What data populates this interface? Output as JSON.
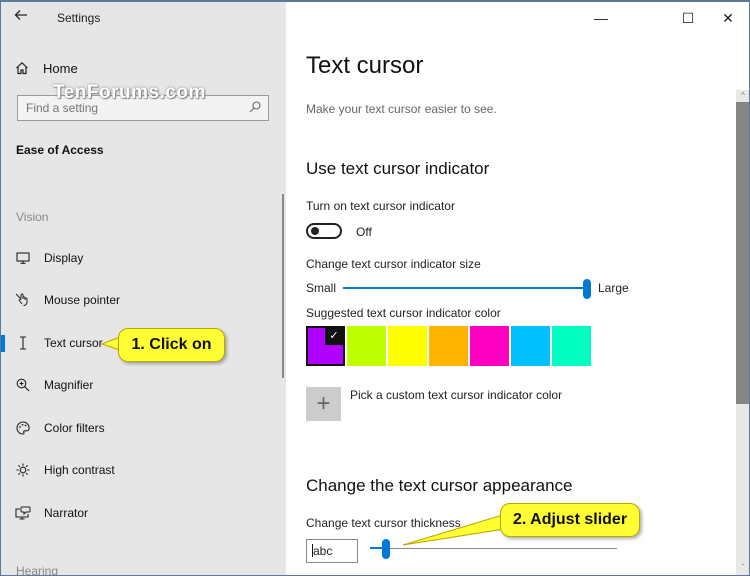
{
  "app": {
    "title": "Settings"
  },
  "sidebar": {
    "home_label": "Home",
    "search": {
      "placeholder": "Find a setting",
      "value": ""
    },
    "section_title": "Ease of Access",
    "groups": [
      {
        "label": "Vision",
        "items": [
          {
            "label": "Display",
            "icon": "display-icon",
            "active": false
          },
          {
            "label": "Mouse pointer",
            "icon": "mouse-pointer-icon",
            "active": false
          },
          {
            "label": "Text cursor",
            "icon": "text-cursor-icon",
            "active": true
          },
          {
            "label": "Magnifier",
            "icon": "magnifier-icon",
            "active": false
          },
          {
            "label": "Color filters",
            "icon": "color-filters-icon",
            "active": false
          },
          {
            "label": "High contrast",
            "icon": "high-contrast-icon",
            "active": false
          },
          {
            "label": "Narrator",
            "icon": "narrator-icon",
            "active": false
          }
        ]
      },
      {
        "label": "Hearing",
        "items": []
      }
    ]
  },
  "watermark": "TenForums.com",
  "annotations": {
    "callout1": "1. Click on",
    "callout2": "2. Adjust slider",
    "color": "#ffff33"
  },
  "window_controls": {
    "minimize": "—",
    "maximize": "☐",
    "close": "✕"
  },
  "main": {
    "title": "Text cursor",
    "description": "Make your text cursor easier to see.",
    "indicator_section": {
      "heading": "Use text cursor indicator",
      "toggle_label": "Turn on text cursor indicator",
      "toggle_state": "Off",
      "toggle_on": false,
      "size_label": "Change text cursor indicator size",
      "size_min_label": "Small",
      "size_max_label": "Large",
      "size_value_fraction": 1.0,
      "color_label": "Suggested text cursor indicator color",
      "colors": [
        {
          "hex": "#b000ff",
          "selected": true
        },
        {
          "hex": "#bfff00",
          "selected": false
        },
        {
          "hex": "#ffff00",
          "selected": false
        },
        {
          "hex": "#ffb400",
          "selected": false
        },
        {
          "hex": "#ff00c0",
          "selected": false
        },
        {
          "hex": "#00c0ff",
          "selected": false
        },
        {
          "hex": "#00ffc0",
          "selected": false
        }
      ],
      "check_glyph": "✓",
      "custom_color_label": "Pick a custom text cursor indicator color",
      "custom_color_glyph": "+"
    },
    "appearance_section": {
      "heading": "Change the text cursor appearance",
      "thickness_label": "Change text cursor thickness",
      "preview_text": "abc",
      "thickness_value_fraction": 0.05
    }
  },
  "accent_color": "#0078d7"
}
